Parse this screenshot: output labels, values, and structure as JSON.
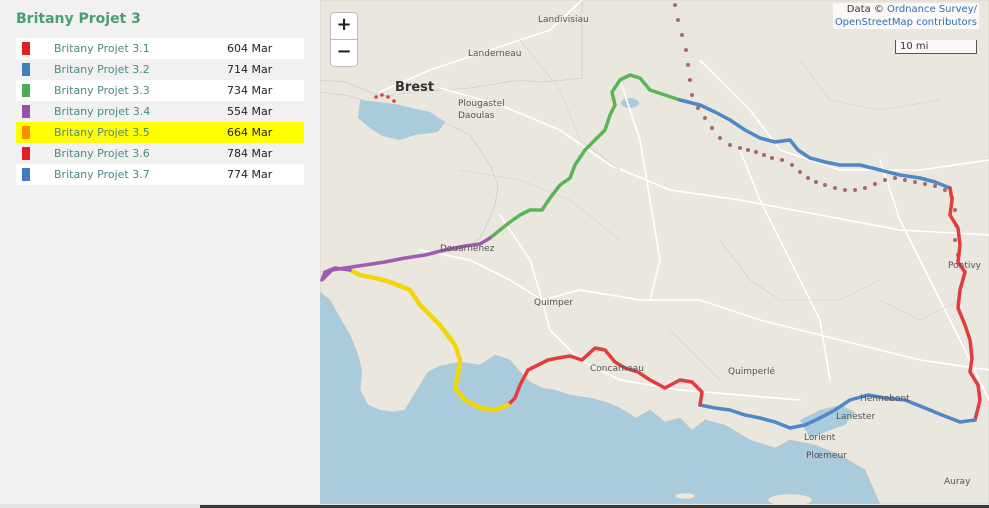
{
  "title": "Britany Projet 3",
  "routes": [
    {
      "name": "Britany Projet 3.1",
      "distance": "60",
      "date": "4 Mar",
      "color": "#e02020"
    },
    {
      "name": "Britany Projet 3.2",
      "distance": "71",
      "date": "4 Mar",
      "color": "#3d7fc0"
    },
    {
      "name": "Britany Projet 3.3",
      "distance": "73",
      "date": "4 Mar",
      "color": "#4caf50"
    },
    {
      "name": "Britany projet 3.4",
      "distance": "55",
      "date": "4 Mar",
      "color": "#9b4fa8"
    },
    {
      "name": "Britany Projet 3.5",
      "distance": "66",
      "date": "4 Mar",
      "color": "#ff8c00"
    },
    {
      "name": "Britany Projet 3.6",
      "distance": "78",
      "date": "4 Mar",
      "color": "#e02020"
    },
    {
      "name": "Britany Projet 3.7",
      "distance": "77",
      "date": "4 Mar",
      "color": "#3d7fc0"
    }
  ],
  "selected_route": "Britany Projet 3.5",
  "map": {
    "zoom_in": "+",
    "zoom_out": "−",
    "attribution_prefix": "Data ©",
    "attribution_link1": "Ordnance Survey/",
    "attribution_link2": "OpenStreetMap contributors",
    "scale": "10 mi",
    "places": {
      "landivisiau": "Landivisiau",
      "landerneau": "Landerneau",
      "brest": "Brest",
      "plougastel": "Plougastel",
      "daoulas": "Daoulas",
      "douarnenez": "Douarnenez",
      "quimper": "Quimper",
      "concarneau": "Concarneau",
      "quimperle": "Quimperlé",
      "hennebont": "Hennebont",
      "lanester": "Lanester",
      "lorient": "Lorient",
      "ploemeur": "Plœmeur",
      "pontivy": "Pontivy",
      "auray": "Auray"
    },
    "highlight_color": "#f5e000"
  }
}
